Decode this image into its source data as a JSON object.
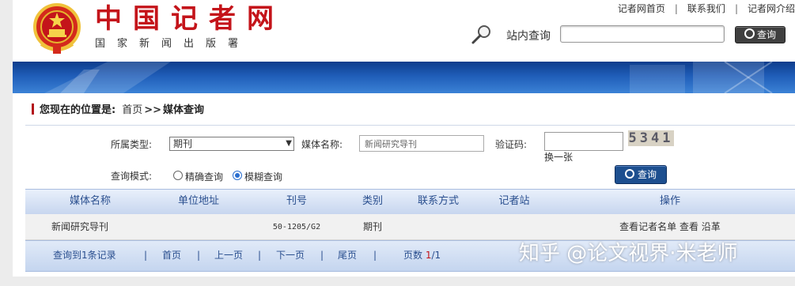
{
  "header": {
    "site_title": "中国记者网",
    "site_subtitle": "国家新闻出版署",
    "top_links": [
      "记者网首页",
      "联系我们",
      "记者网介绍"
    ],
    "search_label": "站内查询",
    "search_value": "",
    "search_button": "查询"
  },
  "breadcrumb": {
    "prefix": "您现在的位置是:",
    "home": "首页",
    "arrows": ">>",
    "current": "媒体查询"
  },
  "form": {
    "type_label": "所属类型:",
    "type_value": "期刊",
    "media_name_label": "媒体名称:",
    "media_name_value": "新闻研究导刊",
    "captcha_label": "验证码:",
    "captcha_value": "",
    "captcha_code": "5341",
    "refresh_label": "换一张",
    "mode_label": "查询模式:",
    "mode_exact": "精确查询",
    "mode_fuzzy": "模糊查询",
    "selected_mode": "模糊查询",
    "query_button": "查询"
  },
  "table": {
    "columns": [
      "媒体名称",
      "单位地址",
      "刊号",
      "类别",
      "联系方式",
      "记者站",
      "操作"
    ],
    "rows": [
      {
        "name": "新闻研究导刊",
        "address": "",
        "code": "50-1205/G2",
        "category": "期刊",
        "contact": "",
        "station": "",
        "actions": "查看记者名单 查看 沿革"
      }
    ]
  },
  "pagination": {
    "summary": "查询到1条记录",
    "first": "首页",
    "prev": "上一页",
    "next": "下一页",
    "last": "尾页",
    "pages_label": "页数",
    "current_page": "1",
    "total_pages": "/1"
  },
  "watermark": "知乎 @论文视界·米老师",
  "colors": {
    "brand_red": "#c4141a",
    "header_blue": "#2a4f8f",
    "banner_blue": "#1f5db8",
    "button_dark": "#3f3f3f",
    "button_blue": "#1d4f8f"
  }
}
